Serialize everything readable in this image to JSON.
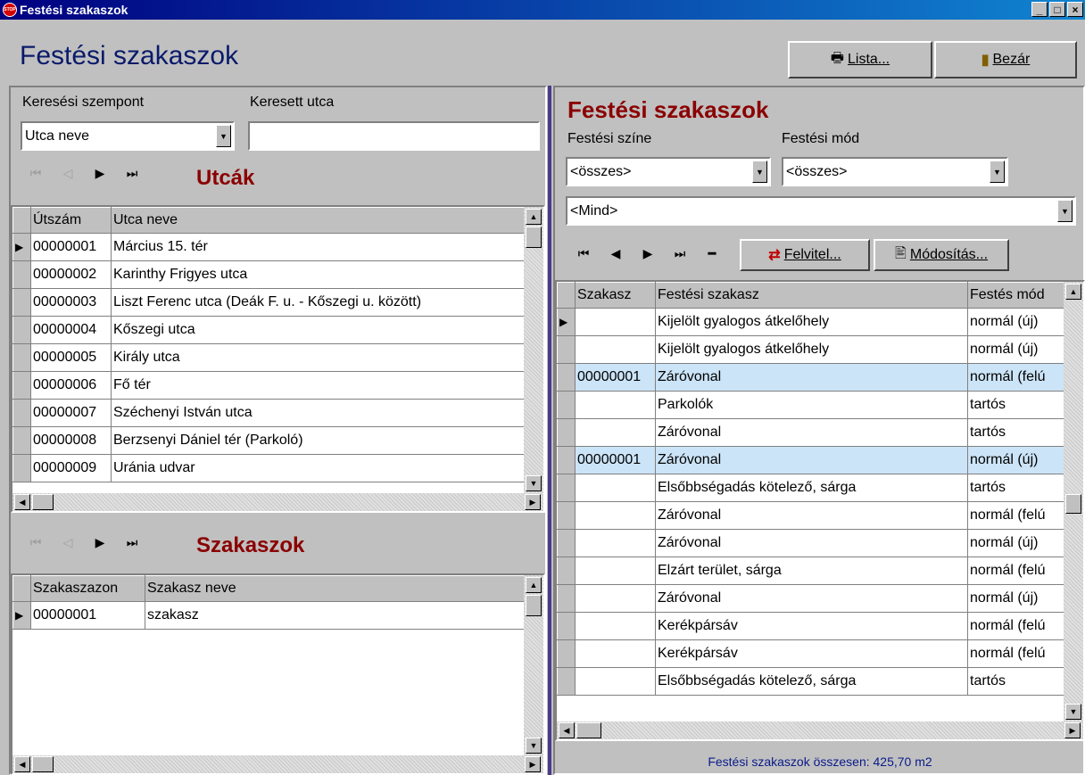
{
  "window": {
    "title": "Festési szakaszok",
    "app_icon": "STOP",
    "min_label": "_",
    "max_label": "□",
    "close_label": "×"
  },
  "header": {
    "title": "Festési szakaszok",
    "lista_label": "Lista...",
    "bezar_label": "Bezár"
  },
  "left": {
    "search_criterion_label": "Keresési szempont",
    "searched_street_label": "Keresett utca",
    "search_criterion_value": "Utca neve",
    "searched_street_value": "",
    "streets_title": "Utcák",
    "streets_columns": [
      "Útszám",
      "Utca neve"
    ],
    "streets_rows": [
      {
        "id": "00000001",
        "name": "Március 15. tér"
      },
      {
        "id": "00000002",
        "name": "Karinthy Frigyes utca"
      },
      {
        "id": "00000003",
        "name": "Liszt Ferenc utca (Deák F. u. - Kőszegi u. között)"
      },
      {
        "id": "00000004",
        "name": "Kőszegi utca"
      },
      {
        "id": "00000005",
        "name": "Király utca"
      },
      {
        "id": "00000006",
        "name": "Fő tér"
      },
      {
        "id": "00000007",
        "name": "Széchenyi István utca"
      },
      {
        "id": "00000008",
        "name": "Berzsenyi Dániel tér (Parkoló)"
      },
      {
        "id": "00000009",
        "name": "Uránia udvar"
      }
    ],
    "sections_title": "Szakaszok",
    "sections_columns": [
      "Szakaszazon",
      "Szakasz neve"
    ],
    "sections_rows": [
      {
        "id": "00000001",
        "name": "szakasz"
      }
    ]
  },
  "right": {
    "title": "Festési szakaszok",
    "color_label": "Festési színe",
    "mode_label": "Festési mód",
    "color_value": "<összes>",
    "mode_value": "<összes>",
    "all_value": "<Mind>",
    "felvitel_label": "Felvitel...",
    "modositas_label": "Módosítás...",
    "columns": [
      "Szakasz",
      "Festési szakasz",
      "Festés mód"
    ],
    "rows": [
      {
        "szakasz": "",
        "name": "Kijelölt gyalogos átkelőhely",
        "mode": "normál (új)",
        "sel": false
      },
      {
        "szakasz": "",
        "name": "Kijelölt gyalogos átkelőhely",
        "mode": "normál (új)",
        "sel": false
      },
      {
        "szakasz": "00000001",
        "name": "Záróvonal",
        "mode": "normál (felú",
        "sel": true
      },
      {
        "szakasz": "",
        "name": "Parkolók",
        "mode": "tartós",
        "sel": false
      },
      {
        "szakasz": "",
        "name": "Záróvonal",
        "mode": "tartós",
        "sel": false
      },
      {
        "szakasz": "00000001",
        "name": "Záróvonal",
        "mode": "normál (új)",
        "sel": true
      },
      {
        "szakasz": "",
        "name": "Elsőbbségadás kötelező, sárga",
        "mode": "tartós",
        "sel": false
      },
      {
        "szakasz": "",
        "name": "Záróvonal",
        "mode": "normál (felú",
        "sel": false
      },
      {
        "szakasz": "",
        "name": "Záróvonal",
        "mode": "normál (új)",
        "sel": false
      },
      {
        "szakasz": "",
        "name": "Elzárt terület, sárga",
        "mode": "normál (felú",
        "sel": false
      },
      {
        "szakasz": "",
        "name": "Záróvonal",
        "mode": "normál (új)",
        "sel": false
      },
      {
        "szakasz": "",
        "name": "Kerékpársáv",
        "mode": "normál (felú",
        "sel": false
      },
      {
        "szakasz": "",
        "name": "Kerékpársáv",
        "mode": "normál (felú",
        "sel": false
      },
      {
        "szakasz": "",
        "name": "Elsőbbségadás kötelező, sárga",
        "mode": "tartós",
        "sel": false
      }
    ],
    "status": "Festési szakaszok összesen: 425,70 m2"
  }
}
